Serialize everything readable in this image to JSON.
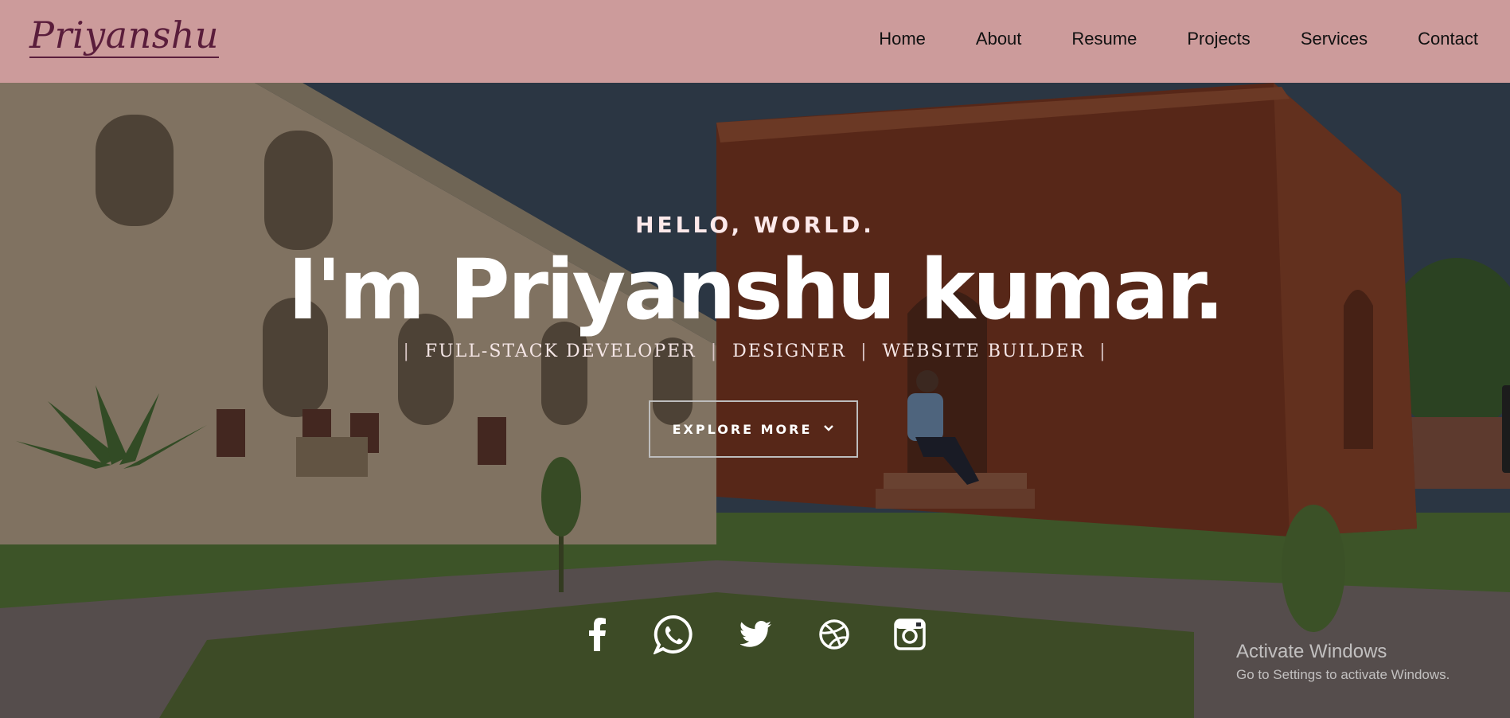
{
  "header": {
    "logo": "Priyanshu",
    "background": "#cc9b9b",
    "nav": [
      {
        "label": "Home"
      },
      {
        "label": "About"
      },
      {
        "label": "Resume"
      },
      {
        "label": "Projects"
      },
      {
        "label": "Services"
      },
      {
        "label": "Contact"
      }
    ]
  },
  "hero": {
    "greeting": "HELLO, WORLD.",
    "headline": "I'm Priyanshu kumar.",
    "roles": [
      "FULL-STACK DEVELOPER",
      "DESIGNER",
      "WEBSITE BUILDER"
    ],
    "separator": "|",
    "cta_label": "EXPLORE MORE",
    "cta_icon": "chevron-down-icon"
  },
  "socials": [
    {
      "icon": "facebook-icon"
    },
    {
      "icon": "whatsapp-icon"
    },
    {
      "icon": "twitter-icon"
    },
    {
      "icon": "dribbble-icon"
    },
    {
      "icon": "instagram-icon"
    }
  ],
  "watermark": {
    "title": "Activate Windows",
    "subtitle": "Go to Settings to activate Windows."
  }
}
